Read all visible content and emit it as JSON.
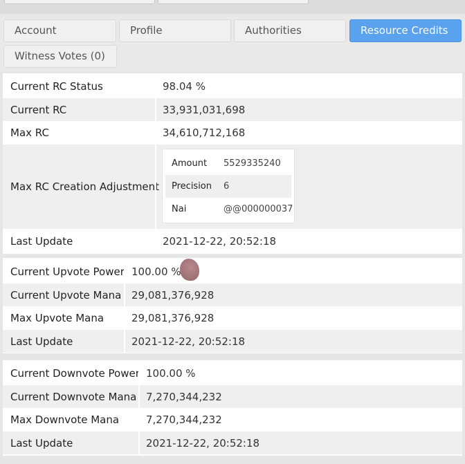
{
  "tabs": [
    {
      "label": "Account",
      "active": false
    },
    {
      "label": "Profile",
      "active": false
    },
    {
      "label": "Authorities",
      "active": false
    },
    {
      "label": "Resource Credits",
      "active": true
    },
    {
      "label": "Witness Votes (0)",
      "active": false
    }
  ],
  "rc": {
    "status_label": "Current RC Status",
    "status_value": "98.04 %",
    "current_label": "Current RC",
    "current_value": "33,931,031,698",
    "max_label": "Max RC",
    "max_value": "34,610,712,168",
    "adjustment_label": "Max RC Creation Adjustment",
    "adjustment": {
      "amount_label": "Amount",
      "amount_value": "5529335240",
      "precision_label": "Precision",
      "precision_value": "6",
      "nai_label": "Nai",
      "nai_value": "@@000000037"
    },
    "last_update_label": "Last Update",
    "last_update_value": "2021-12-22, 20:52:18"
  },
  "upvote": {
    "power_label": "Current Upvote Power",
    "power_value": "100.00 %",
    "mana_label": "Current Upvote Mana",
    "mana_value": "29,081,376,928",
    "max_label": "Max Upvote Mana",
    "max_value": "29,081,376,928",
    "last_update_label": "Last Update",
    "last_update_value": "2021-12-22, 20:52:18"
  },
  "downvote": {
    "power_label": "Current Downvote Power",
    "power_value": "100.00 %",
    "mana_label": "Current Downvote Mana",
    "mana_value": "7,270,344,232",
    "max_label": "Max Downvote Mana",
    "max_value": "7,270,344,232",
    "last_update_label": "Last Update",
    "last_update_value": "2021-12-22, 20:52:18"
  },
  "colors": {
    "active_tab": "#5aa2ee",
    "row_alt": "#efefef",
    "background": "#e6e6e6"
  }
}
